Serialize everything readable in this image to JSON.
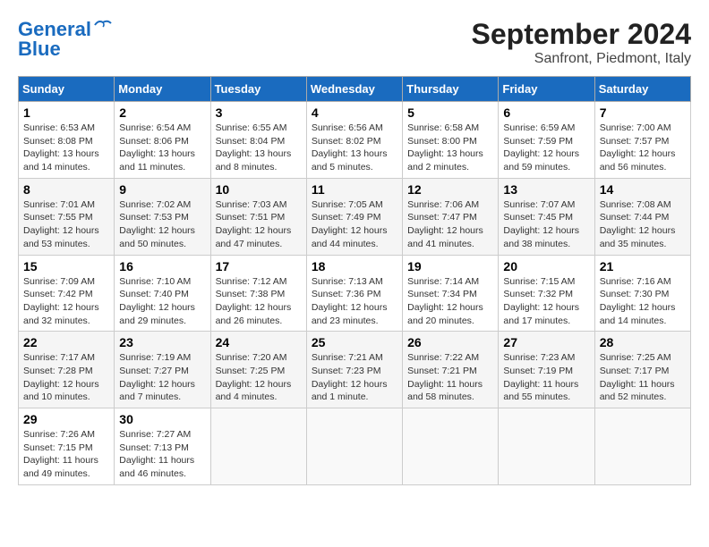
{
  "header": {
    "logo_line1": "General",
    "logo_line2": "Blue",
    "title": "September 2024",
    "subtitle": "Sanfront, Piedmont, Italy"
  },
  "weekdays": [
    "Sunday",
    "Monday",
    "Tuesday",
    "Wednesday",
    "Thursday",
    "Friday",
    "Saturday"
  ],
  "weeks": [
    [
      {
        "day": "1",
        "sunrise": "Sunrise: 6:53 AM",
        "sunset": "Sunset: 8:08 PM",
        "daylight": "Daylight: 13 hours and 14 minutes."
      },
      {
        "day": "2",
        "sunrise": "Sunrise: 6:54 AM",
        "sunset": "Sunset: 8:06 PM",
        "daylight": "Daylight: 13 hours and 11 minutes."
      },
      {
        "day": "3",
        "sunrise": "Sunrise: 6:55 AM",
        "sunset": "Sunset: 8:04 PM",
        "daylight": "Daylight: 13 hours and 8 minutes."
      },
      {
        "day": "4",
        "sunrise": "Sunrise: 6:56 AM",
        "sunset": "Sunset: 8:02 PM",
        "daylight": "Daylight: 13 hours and 5 minutes."
      },
      {
        "day": "5",
        "sunrise": "Sunrise: 6:58 AM",
        "sunset": "Sunset: 8:00 PM",
        "daylight": "Daylight: 13 hours and 2 minutes."
      },
      {
        "day": "6",
        "sunrise": "Sunrise: 6:59 AM",
        "sunset": "Sunset: 7:59 PM",
        "daylight": "Daylight: 12 hours and 59 minutes."
      },
      {
        "day": "7",
        "sunrise": "Sunrise: 7:00 AM",
        "sunset": "Sunset: 7:57 PM",
        "daylight": "Daylight: 12 hours and 56 minutes."
      }
    ],
    [
      {
        "day": "8",
        "sunrise": "Sunrise: 7:01 AM",
        "sunset": "Sunset: 7:55 PM",
        "daylight": "Daylight: 12 hours and 53 minutes."
      },
      {
        "day": "9",
        "sunrise": "Sunrise: 7:02 AM",
        "sunset": "Sunset: 7:53 PM",
        "daylight": "Daylight: 12 hours and 50 minutes."
      },
      {
        "day": "10",
        "sunrise": "Sunrise: 7:03 AM",
        "sunset": "Sunset: 7:51 PM",
        "daylight": "Daylight: 12 hours and 47 minutes."
      },
      {
        "day": "11",
        "sunrise": "Sunrise: 7:05 AM",
        "sunset": "Sunset: 7:49 PM",
        "daylight": "Daylight: 12 hours and 44 minutes."
      },
      {
        "day": "12",
        "sunrise": "Sunrise: 7:06 AM",
        "sunset": "Sunset: 7:47 PM",
        "daylight": "Daylight: 12 hours and 41 minutes."
      },
      {
        "day": "13",
        "sunrise": "Sunrise: 7:07 AM",
        "sunset": "Sunset: 7:45 PM",
        "daylight": "Daylight: 12 hours and 38 minutes."
      },
      {
        "day": "14",
        "sunrise": "Sunrise: 7:08 AM",
        "sunset": "Sunset: 7:44 PM",
        "daylight": "Daylight: 12 hours and 35 minutes."
      }
    ],
    [
      {
        "day": "15",
        "sunrise": "Sunrise: 7:09 AM",
        "sunset": "Sunset: 7:42 PM",
        "daylight": "Daylight: 12 hours and 32 minutes."
      },
      {
        "day": "16",
        "sunrise": "Sunrise: 7:10 AM",
        "sunset": "Sunset: 7:40 PM",
        "daylight": "Daylight: 12 hours and 29 minutes."
      },
      {
        "day": "17",
        "sunrise": "Sunrise: 7:12 AM",
        "sunset": "Sunset: 7:38 PM",
        "daylight": "Daylight: 12 hours and 26 minutes."
      },
      {
        "day": "18",
        "sunrise": "Sunrise: 7:13 AM",
        "sunset": "Sunset: 7:36 PM",
        "daylight": "Daylight: 12 hours and 23 minutes."
      },
      {
        "day": "19",
        "sunrise": "Sunrise: 7:14 AM",
        "sunset": "Sunset: 7:34 PM",
        "daylight": "Daylight: 12 hours and 20 minutes."
      },
      {
        "day": "20",
        "sunrise": "Sunrise: 7:15 AM",
        "sunset": "Sunset: 7:32 PM",
        "daylight": "Daylight: 12 hours and 17 minutes."
      },
      {
        "day": "21",
        "sunrise": "Sunrise: 7:16 AM",
        "sunset": "Sunset: 7:30 PM",
        "daylight": "Daylight: 12 hours and 14 minutes."
      }
    ],
    [
      {
        "day": "22",
        "sunrise": "Sunrise: 7:17 AM",
        "sunset": "Sunset: 7:28 PM",
        "daylight": "Daylight: 12 hours and 10 minutes."
      },
      {
        "day": "23",
        "sunrise": "Sunrise: 7:19 AM",
        "sunset": "Sunset: 7:27 PM",
        "daylight": "Daylight: 12 hours and 7 minutes."
      },
      {
        "day": "24",
        "sunrise": "Sunrise: 7:20 AM",
        "sunset": "Sunset: 7:25 PM",
        "daylight": "Daylight: 12 hours and 4 minutes."
      },
      {
        "day": "25",
        "sunrise": "Sunrise: 7:21 AM",
        "sunset": "Sunset: 7:23 PM",
        "daylight": "Daylight: 12 hours and 1 minute."
      },
      {
        "day": "26",
        "sunrise": "Sunrise: 7:22 AM",
        "sunset": "Sunset: 7:21 PM",
        "daylight": "Daylight: 11 hours and 58 minutes."
      },
      {
        "day": "27",
        "sunrise": "Sunrise: 7:23 AM",
        "sunset": "Sunset: 7:19 PM",
        "daylight": "Daylight: 11 hours and 55 minutes."
      },
      {
        "day": "28",
        "sunrise": "Sunrise: 7:25 AM",
        "sunset": "Sunset: 7:17 PM",
        "daylight": "Daylight: 11 hours and 52 minutes."
      }
    ],
    [
      {
        "day": "29",
        "sunrise": "Sunrise: 7:26 AM",
        "sunset": "Sunset: 7:15 PM",
        "daylight": "Daylight: 11 hours and 49 minutes."
      },
      {
        "day": "30",
        "sunrise": "Sunrise: 7:27 AM",
        "sunset": "Sunset: 7:13 PM",
        "daylight": "Daylight: 11 hours and 46 minutes."
      },
      null,
      null,
      null,
      null,
      null
    ]
  ]
}
